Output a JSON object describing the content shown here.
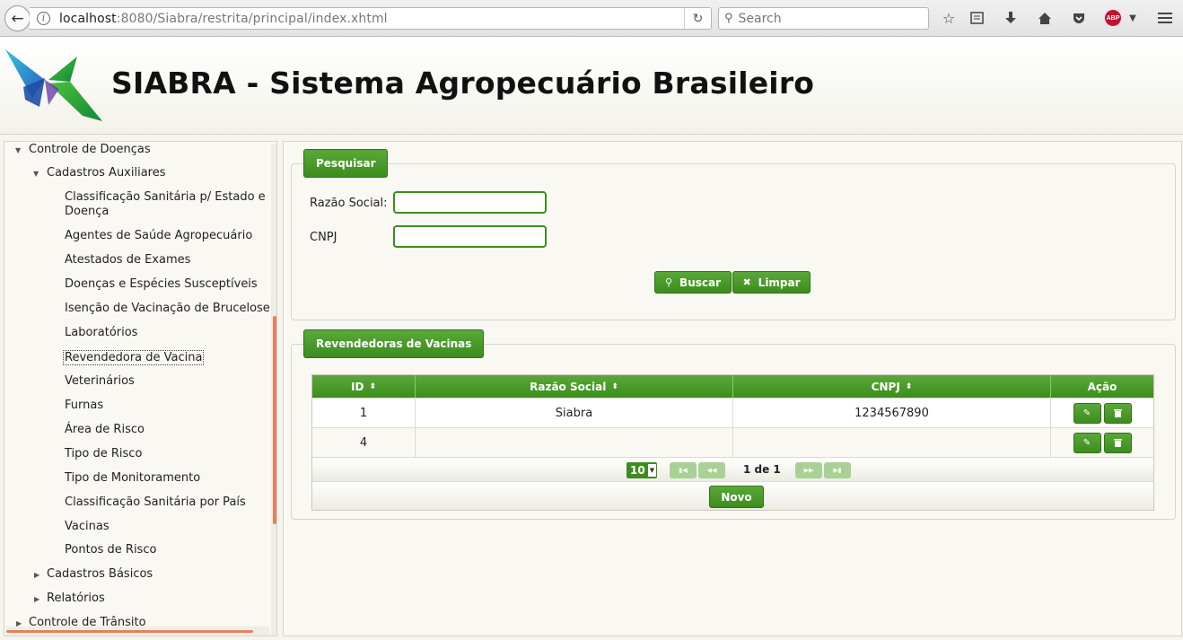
{
  "browser": {
    "url_host": "localhost",
    "url_rest": ":8080/Siabra/restrita/principal/index.xhtml",
    "search_placeholder": "Search",
    "abp_label": "ABP"
  },
  "app": {
    "title": "SIABRA - Sistema Agropecuário Brasileiro"
  },
  "sidebar": {
    "items": [
      {
        "label": "Controle de Doenças"
      },
      {
        "label": "Cadastros Auxiliares"
      },
      {
        "label": "Classificação Sanitária p/ Estado e"
      },
      {
        "label": "Doença"
      },
      {
        "label": "Agentes de Saúde Agropecuário"
      },
      {
        "label": "Atestados de Exames"
      },
      {
        "label": "Doenças e Espécies Susceptíveis"
      },
      {
        "label": "Isenção de Vacinação de Brucelose"
      },
      {
        "label": "Laboratórios"
      },
      {
        "label": "Revendedora de Vacina"
      },
      {
        "label": "Veterinários"
      },
      {
        "label": "Furnas"
      },
      {
        "label": "Área de Risco"
      },
      {
        "label": "Tipo de Risco"
      },
      {
        "label": "Tipo de Monitoramento"
      },
      {
        "label": "Classificação Sanitária por País"
      },
      {
        "label": "Vacinas"
      },
      {
        "label": "Pontos de Risco"
      },
      {
        "label": "Cadastros Básicos"
      },
      {
        "label": "Relatórios"
      },
      {
        "label": "Controle de Trânsito"
      }
    ]
  },
  "search_panel": {
    "legend": "Pesquisar",
    "razao_label": "Razão Social:",
    "razao_value": "",
    "cnpj_label": "CNPJ",
    "cnpj_value": "",
    "buscar_label": "Buscar",
    "limpar_label": "Limpar"
  },
  "results_panel": {
    "legend": "Revendedoras de Vacinas",
    "columns": [
      "ID",
      "Razão Social",
      "CNPJ",
      "Ação"
    ],
    "rows": [
      {
        "id": "1",
        "razao": "Siabra",
        "cnpj": "1234567890"
      },
      {
        "id": "4",
        "razao": "",
        "cnpj": ""
      }
    ],
    "rows_per_page": "10",
    "page_info": "1 de 1",
    "novo_label": "Novo"
  },
  "colors": {
    "accent_green": "#3c8d1d",
    "scroll_orange": "#e97f5e"
  }
}
